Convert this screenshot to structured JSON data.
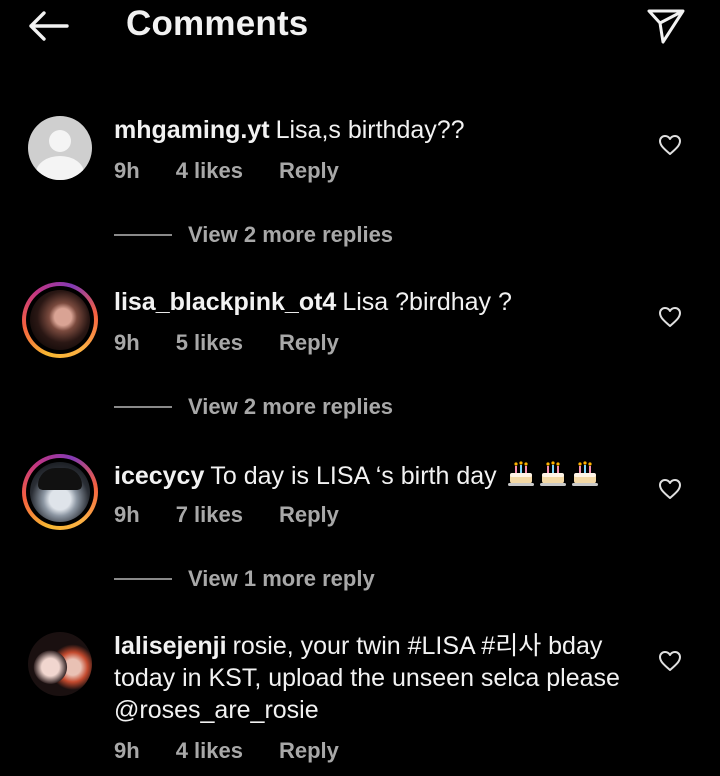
{
  "header": {
    "title": "Comments",
    "back_icon": "arrow-left-icon",
    "send_icon": "paper-plane-icon"
  },
  "comments": [
    {
      "username": "mhgaming.yt",
      "text": "Lisa,s birthday??",
      "time": "9h",
      "likes": "4 likes",
      "reply": "Reply",
      "view_replies": "View 2 more replies",
      "avatar": "default-profile-avatar"
    },
    {
      "username": "lisa_blackpink_ot4",
      "text": "Lisa ?birdhay ?",
      "time": "9h",
      "likes": "5 likes",
      "reply": "Reply",
      "view_replies": "View 2 more replies",
      "avatar": "story-ring-avatar"
    },
    {
      "username": "icecycy",
      "text": "To day is LISA ‘s birth day",
      "emoji": [
        "birthday-cake-emoji",
        "birthday-cake-emoji",
        "birthday-cake-emoji"
      ],
      "time": "9h",
      "likes": "7 likes",
      "reply": "Reply",
      "view_replies": "View 1 more reply",
      "avatar": "story-ring-avatar"
    },
    {
      "username": "lalisejenji",
      "text": "rosie, your twin #LISA #리사 bday today in KST, upload the unseen selca please @roses_are_rosie",
      "time": "9h",
      "likes": "4 likes",
      "reply": "Reply",
      "avatar": "profile-avatar"
    }
  ],
  "colors": {
    "background": "#000000",
    "text_primary": "#f2f2f2",
    "text_secondary": "#a8a8a8",
    "story_ring": "#c13584"
  }
}
